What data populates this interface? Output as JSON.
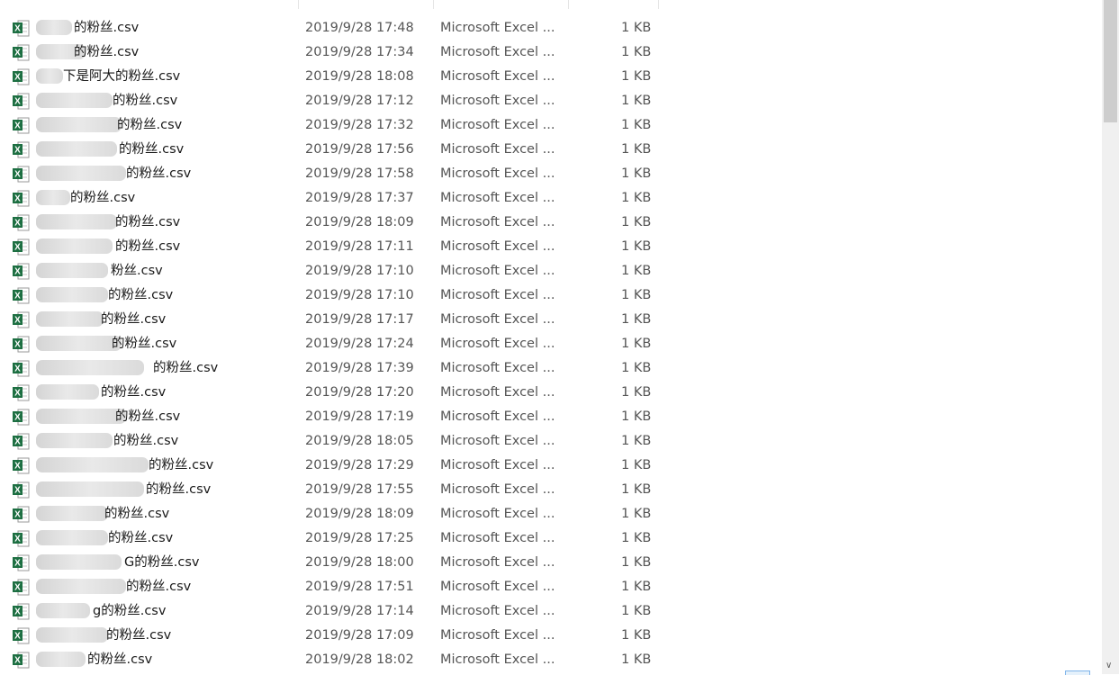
{
  "colors": {
    "excel_green": "#1d6f42",
    "text": "#1a1a1a",
    "meta_text": "#555555"
  },
  "files": [
    {
      "name": "的粉丝.csv",
      "date": "2019/9/28 17:48",
      "type": "Microsoft Excel ...",
      "size": "1 KB"
    },
    {
      "name": "的粉丝.csv",
      "date": "2019/9/28 17:34",
      "type": "Microsoft Excel ...",
      "size": "1 KB"
    },
    {
      "name": "下是阿大的粉丝.csv",
      "date": "2019/9/28 18:08",
      "type": "Microsoft Excel ...",
      "size": "1 KB"
    },
    {
      "name": "的粉丝.csv",
      "date": "2019/9/28 17:12",
      "type": "Microsoft Excel ...",
      "size": "1 KB"
    },
    {
      "name": "的粉丝.csv",
      "date": "2019/9/28 17:32",
      "type": "Microsoft Excel ...",
      "size": "1 KB"
    },
    {
      "name": "的粉丝.csv",
      "date": "2019/9/28 17:56",
      "type": "Microsoft Excel ...",
      "size": "1 KB"
    },
    {
      "name": "的粉丝.csv",
      "date": "2019/9/28 17:58",
      "type": "Microsoft Excel ...",
      "size": "1 KB"
    },
    {
      "name": "的粉丝.csv",
      "date": "2019/9/28 17:37",
      "type": "Microsoft Excel ...",
      "size": "1 KB"
    },
    {
      "name": "的粉丝.csv",
      "date": "2019/9/28 18:09",
      "type": "Microsoft Excel ...",
      "size": "1 KB"
    },
    {
      "name": "的粉丝.csv",
      "date": "2019/9/28 17:11",
      "type": "Microsoft Excel ...",
      "size": "1 KB"
    },
    {
      "name": "粉丝.csv",
      "date": "2019/9/28 17:10",
      "type": "Microsoft Excel ...",
      "size": "1 KB"
    },
    {
      "name": "的粉丝.csv",
      "date": "2019/9/28 17:10",
      "type": "Microsoft Excel ...",
      "size": "1 KB"
    },
    {
      "name": "的粉丝.csv",
      "date": "2019/9/28 17:17",
      "type": "Microsoft Excel ...",
      "size": "1 KB"
    },
    {
      "name": "的粉丝.csv",
      "date": "2019/9/28 17:24",
      "type": "Microsoft Excel ...",
      "size": "1 KB"
    },
    {
      "name": "的粉丝.csv",
      "date": "2019/9/28 17:39",
      "type": "Microsoft Excel ...",
      "size": "1 KB"
    },
    {
      "name": "的粉丝.csv",
      "date": "2019/9/28 17:20",
      "type": "Microsoft Excel ...",
      "size": "1 KB"
    },
    {
      "name": "的粉丝.csv",
      "date": "2019/9/28 17:19",
      "type": "Microsoft Excel ...",
      "size": "1 KB"
    },
    {
      "name": "的粉丝.csv",
      "date": "2019/9/28 18:05",
      "type": "Microsoft Excel ...",
      "size": "1 KB"
    },
    {
      "name": "的粉丝.csv",
      "date": "2019/9/28 17:29",
      "type": "Microsoft Excel ...",
      "size": "1 KB"
    },
    {
      "name": "的粉丝.csv",
      "date": "2019/9/28 17:55",
      "type": "Microsoft Excel ...",
      "size": "1 KB"
    },
    {
      "name": "的粉丝.csv",
      "date": "2019/9/28 18:09",
      "type": "Microsoft Excel ...",
      "size": "1 KB"
    },
    {
      "name": "的粉丝.csv",
      "date": "2019/9/28 17:25",
      "type": "Microsoft Excel ...",
      "size": "1 KB"
    },
    {
      "name": "G的粉丝.csv",
      "date": "2019/9/28 18:00",
      "type": "Microsoft Excel ...",
      "size": "1 KB"
    },
    {
      "name": "的粉丝.csv",
      "date": "2019/9/28 17:51",
      "type": "Microsoft Excel ...",
      "size": "1 KB"
    },
    {
      "name": "g的粉丝.csv",
      "date": "2019/9/28 17:14",
      "type": "Microsoft Excel ...",
      "size": "1 KB"
    },
    {
      "name": "的粉丝.csv",
      "date": "2019/9/28 17:09",
      "type": "Microsoft Excel ...",
      "size": "1 KB"
    },
    {
      "name": "的粉丝.csv",
      "date": "2019/9/28 18:02",
      "type": "Microsoft Excel ...",
      "size": "1 KB"
    }
  ],
  "scrollbar": {
    "down_arrow": "∨"
  }
}
